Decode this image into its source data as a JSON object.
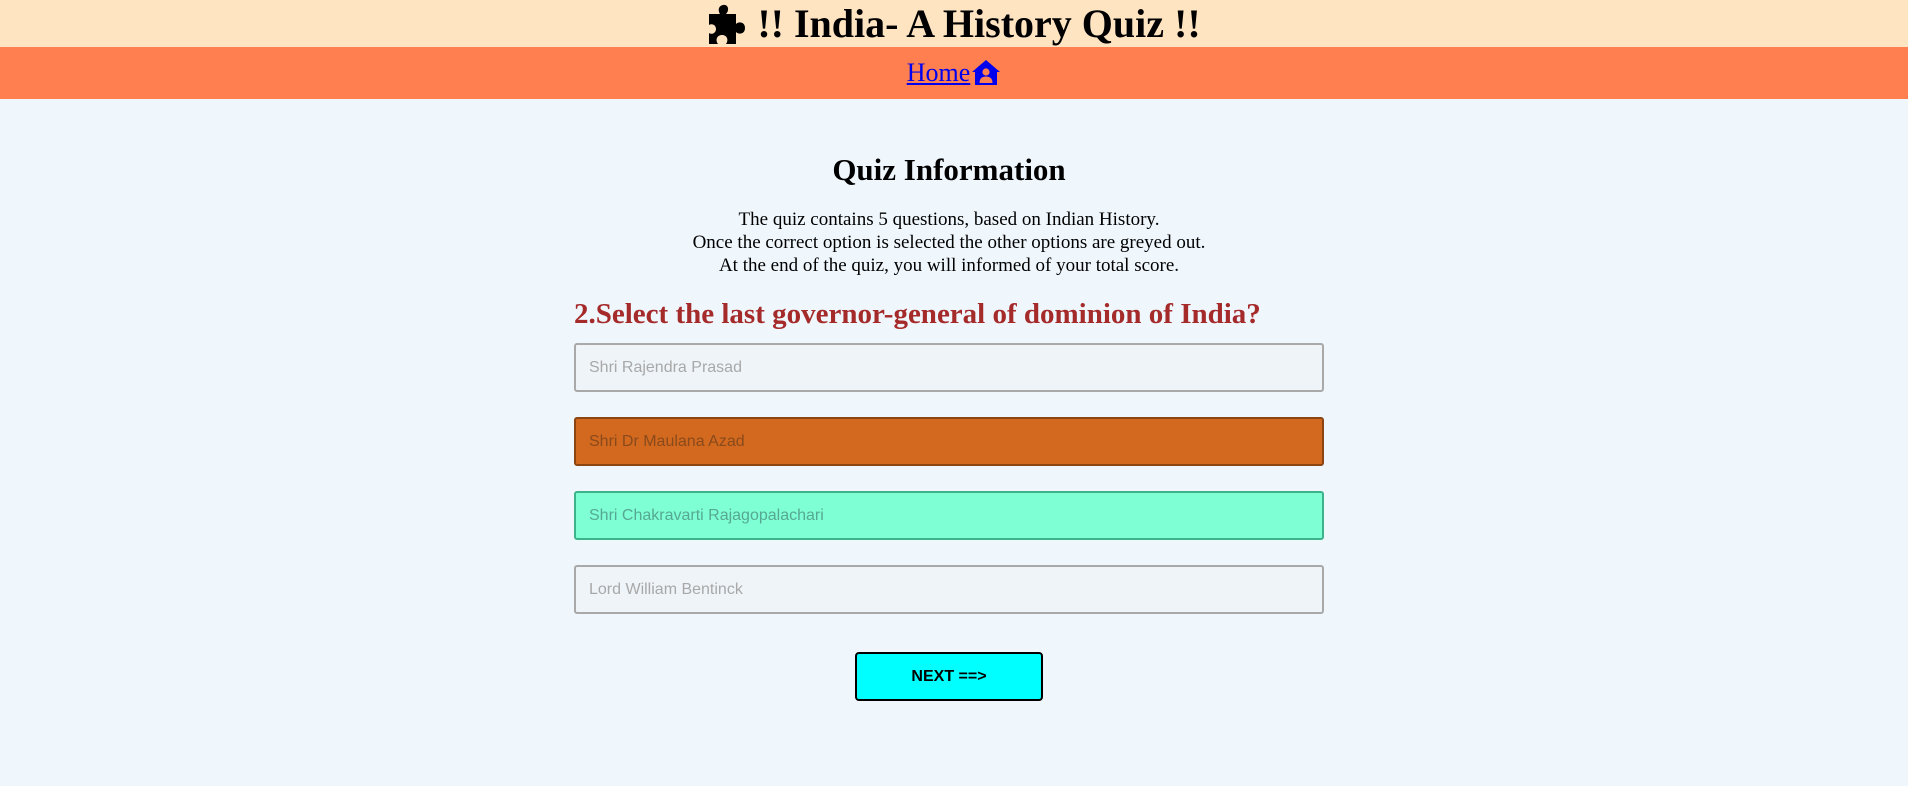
{
  "header": {
    "title": "!! India- A History Quiz !!",
    "icon": "puzzle-piece-icon",
    "background": "#ffe4c2"
  },
  "nav": {
    "home_label": "Home",
    "home_icon": "house-user-icon",
    "background": "#ff7f50",
    "link_color": "#0000ee"
  },
  "info": {
    "title": "Quiz Information",
    "lines": [
      "The quiz contains 5 questions, based on Indian History.",
      "Once the correct option is selected the other options are greyed out.",
      "At the end of the quiz, you will informed of your total score."
    ]
  },
  "quiz": {
    "question": "2.Select the last governor-general of dominion of India?",
    "question_color": "#a52a2a",
    "options": [
      {
        "label": "Shri Rajendra Prasad",
        "state": "disabled"
      },
      {
        "label": "Shri Dr Maulana Azad",
        "state": "wrong"
      },
      {
        "label": "Shri Chakravarti Rajagopalachari",
        "state": "correct"
      },
      {
        "label": "Lord William Bentinck",
        "state": "disabled"
      }
    ],
    "wrong_color": "#d2691e",
    "correct_color": "#7fffd4"
  },
  "next_button": {
    "label": "NEXT ==>",
    "color": "#00ffff"
  }
}
